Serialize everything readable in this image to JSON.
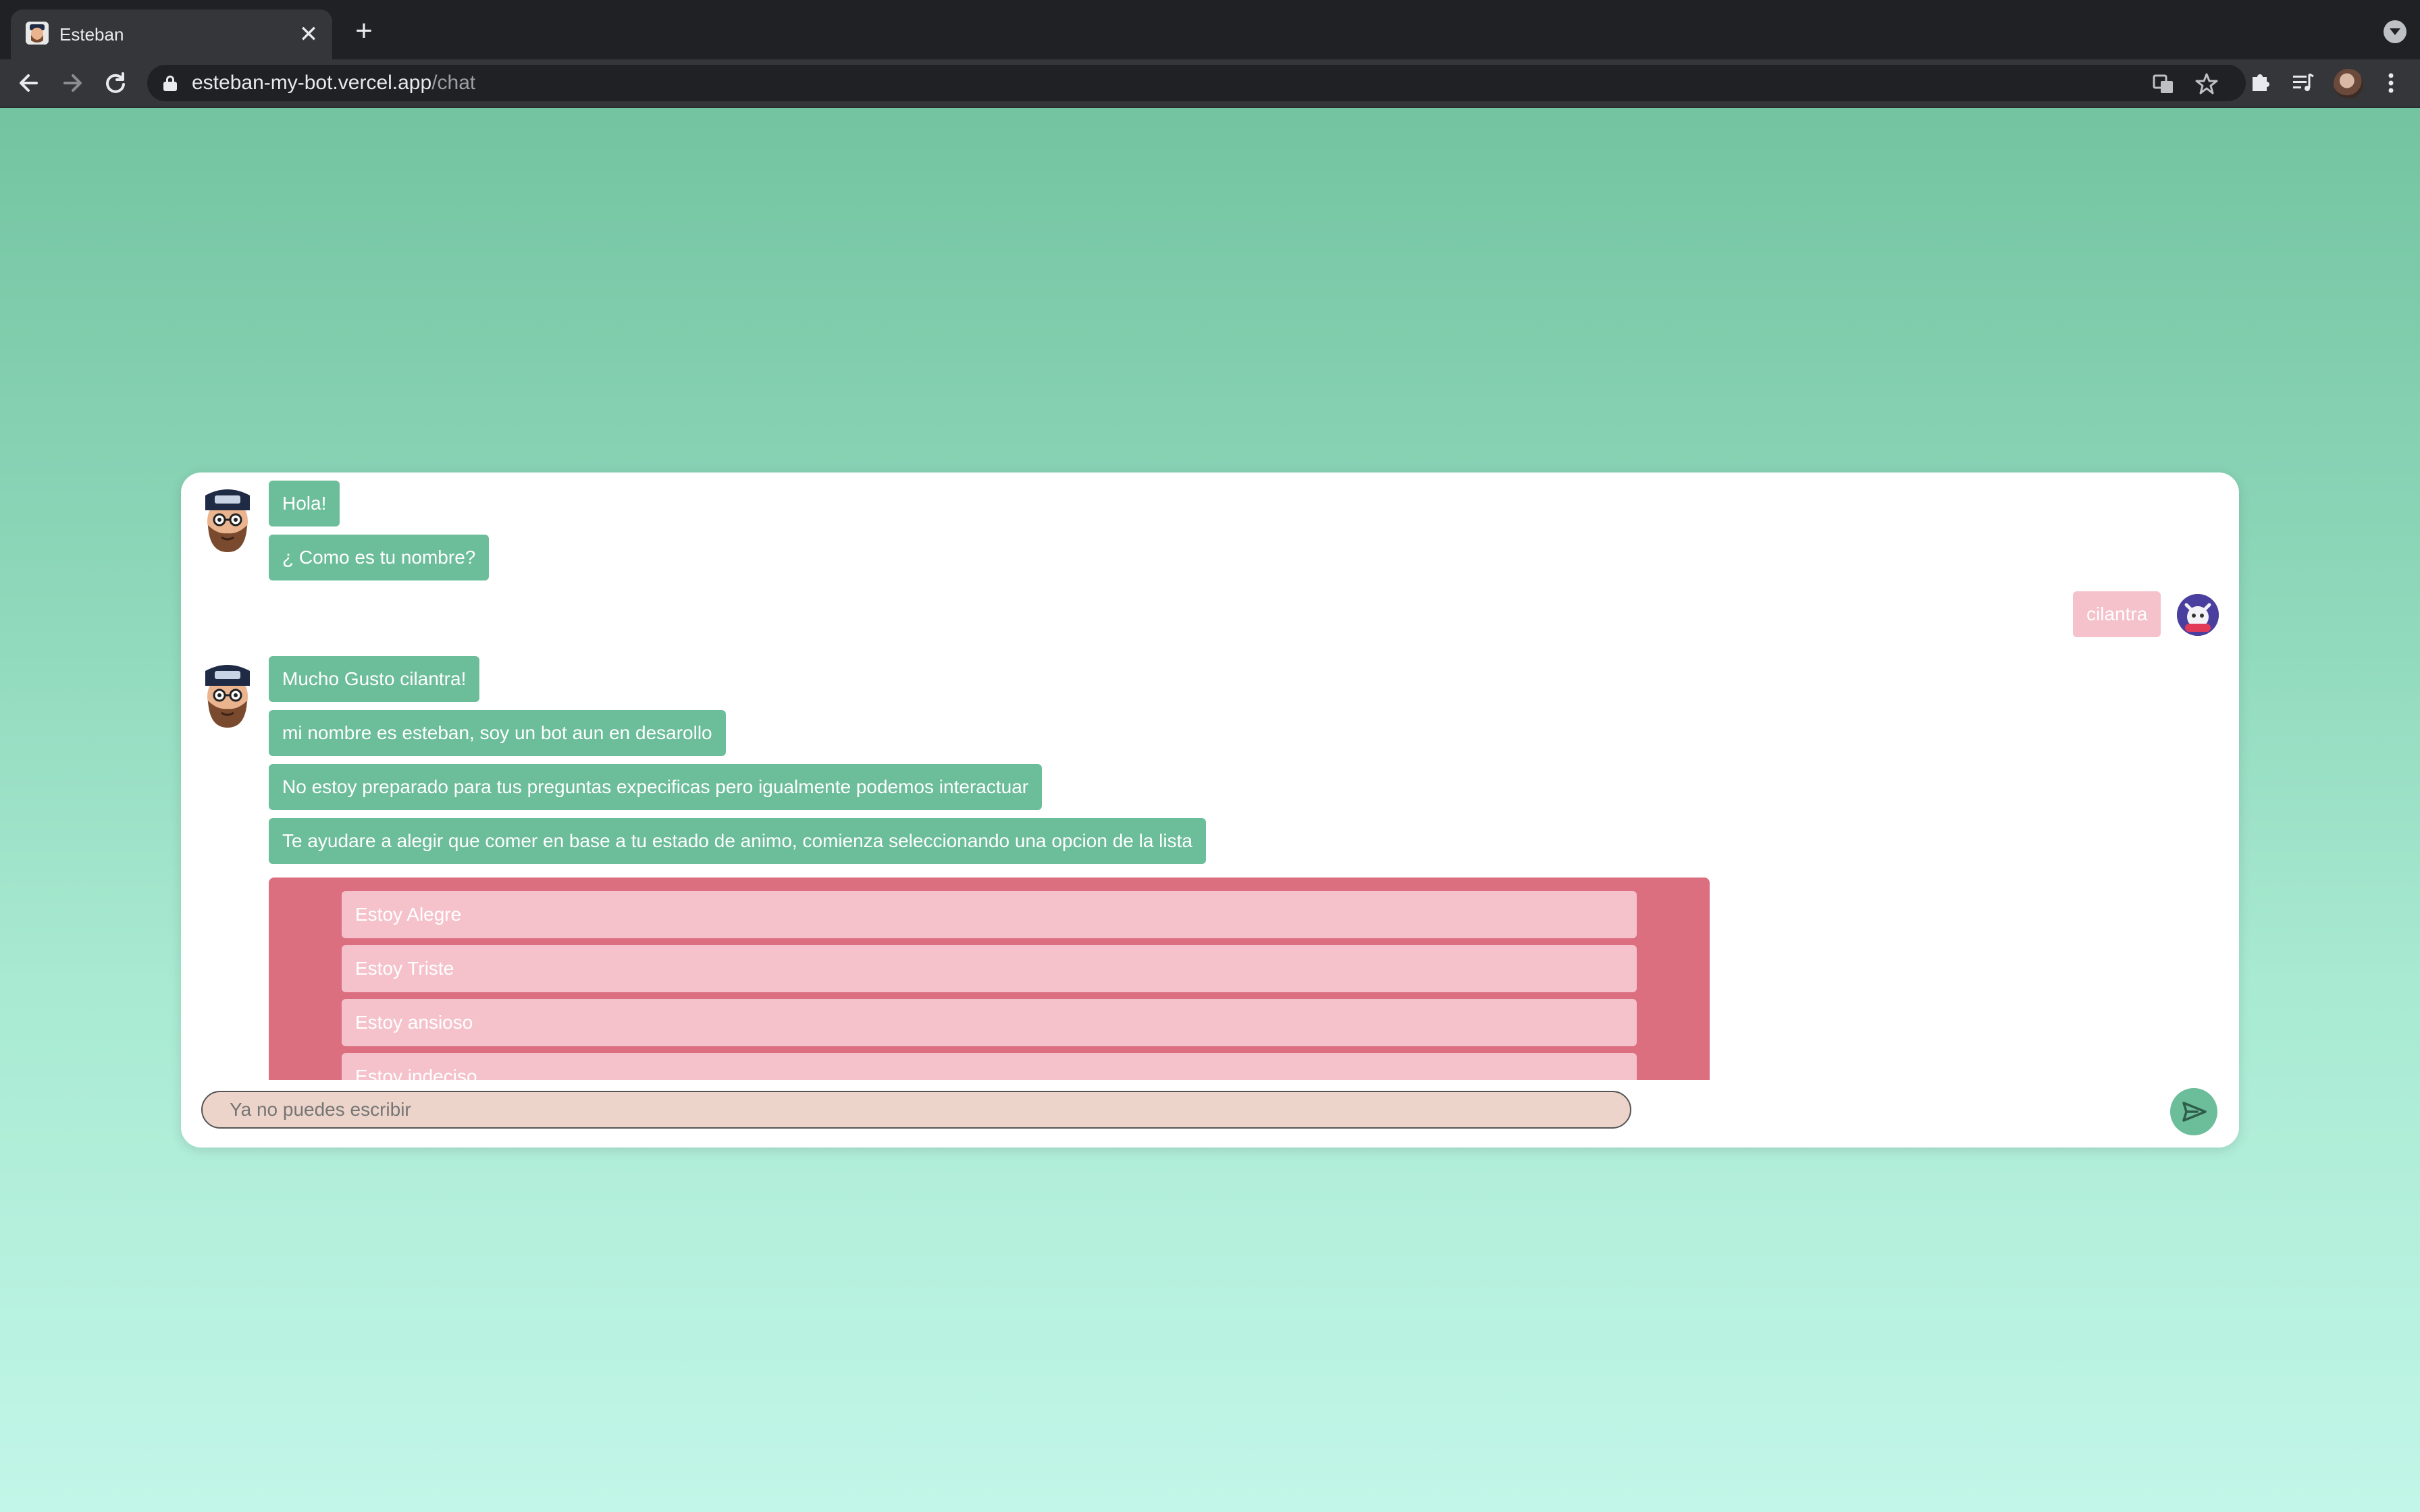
{
  "browser": {
    "tab_title": "Esteban",
    "tab_close": "✕",
    "new_tab": "+",
    "url_host": "esteban-my-bot.vercel.app",
    "url_path": "/chat"
  },
  "chat": {
    "bot_group_1": [
      "Hola!",
      "¿ Como es tu nombre?"
    ],
    "user_message": "cilantra",
    "bot_group_2": [
      "Mucho Gusto cilantra!",
      "mi nombre es esteban, soy un bot aun en desarollo",
      "No estoy preparado para tus preguntas expecificas pero igualmente podemos interactuar",
      "Te ayudare a alegir que comer en base a tu estado de animo, comienza seleccionando una opcion de la lista"
    ],
    "options": [
      "Estoy Alegre",
      "Estoy Triste",
      "Estoy ansioso",
      "Estoy indeciso"
    ],
    "input_placeholder": "Ya no puedes escribir"
  },
  "colors": {
    "bot_bubble": "#6cbd9a",
    "user_bubble": "#f5c1cb",
    "options_panel": "#db6e7f",
    "option_item": "#f5c2cb",
    "input_bg": "#ecd4ca"
  },
  "icons": {
    "back": "arrow-left-icon",
    "forward": "arrow-right-icon",
    "reload": "reload-icon",
    "lock": "lock-icon",
    "translate": "translate-icon",
    "bookmark": "star-icon",
    "extensions": "puzzle-icon",
    "media": "media-queue-icon",
    "menu": "kebab-menu-icon",
    "send": "send-icon"
  }
}
